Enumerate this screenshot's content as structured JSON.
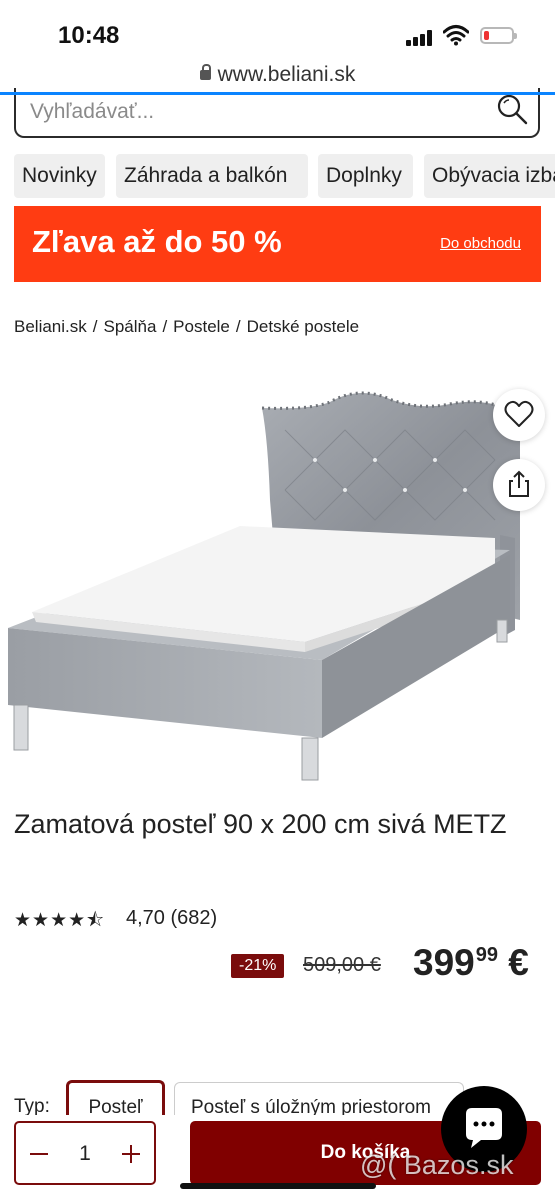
{
  "status": {
    "time": "10:48"
  },
  "browser": {
    "url": "www.beliani.sk"
  },
  "search": {
    "placeholder": "Vyhľadávať..."
  },
  "nav": [
    "Novinky",
    "Záhrada a balkón",
    "Doplnky",
    "Obývacia izba"
  ],
  "banner": {
    "title": "Zľava až do 50 %",
    "link": "Do obchodu",
    "color": "#ff3c12"
  },
  "breadcrumb": [
    "Beliani.sk",
    "Spálňa",
    "Postele",
    "Detské postele"
  ],
  "breadcrumb_separator": "/",
  "product": {
    "title": "Zamatová posteľ 90 x 200 cm sivá METZ",
    "stars_icon": "★★★★⯪",
    "rating": "4,70 (682)",
    "discount": "-21%",
    "old_price": "509,00 €",
    "price_main": "399",
    "price_cents": "99",
    "currency": "€"
  },
  "options": {
    "label": "Typ:",
    "items": [
      "Posteľ",
      "Posteľ s úložným priestorom"
    ]
  },
  "quantity": "1",
  "cart_button": "Do košíka",
  "watermark": "@( Bazos.sk",
  "colors": {
    "accent": "#800000",
    "banner": "#ff3c12",
    "link": "#0a84ff"
  }
}
